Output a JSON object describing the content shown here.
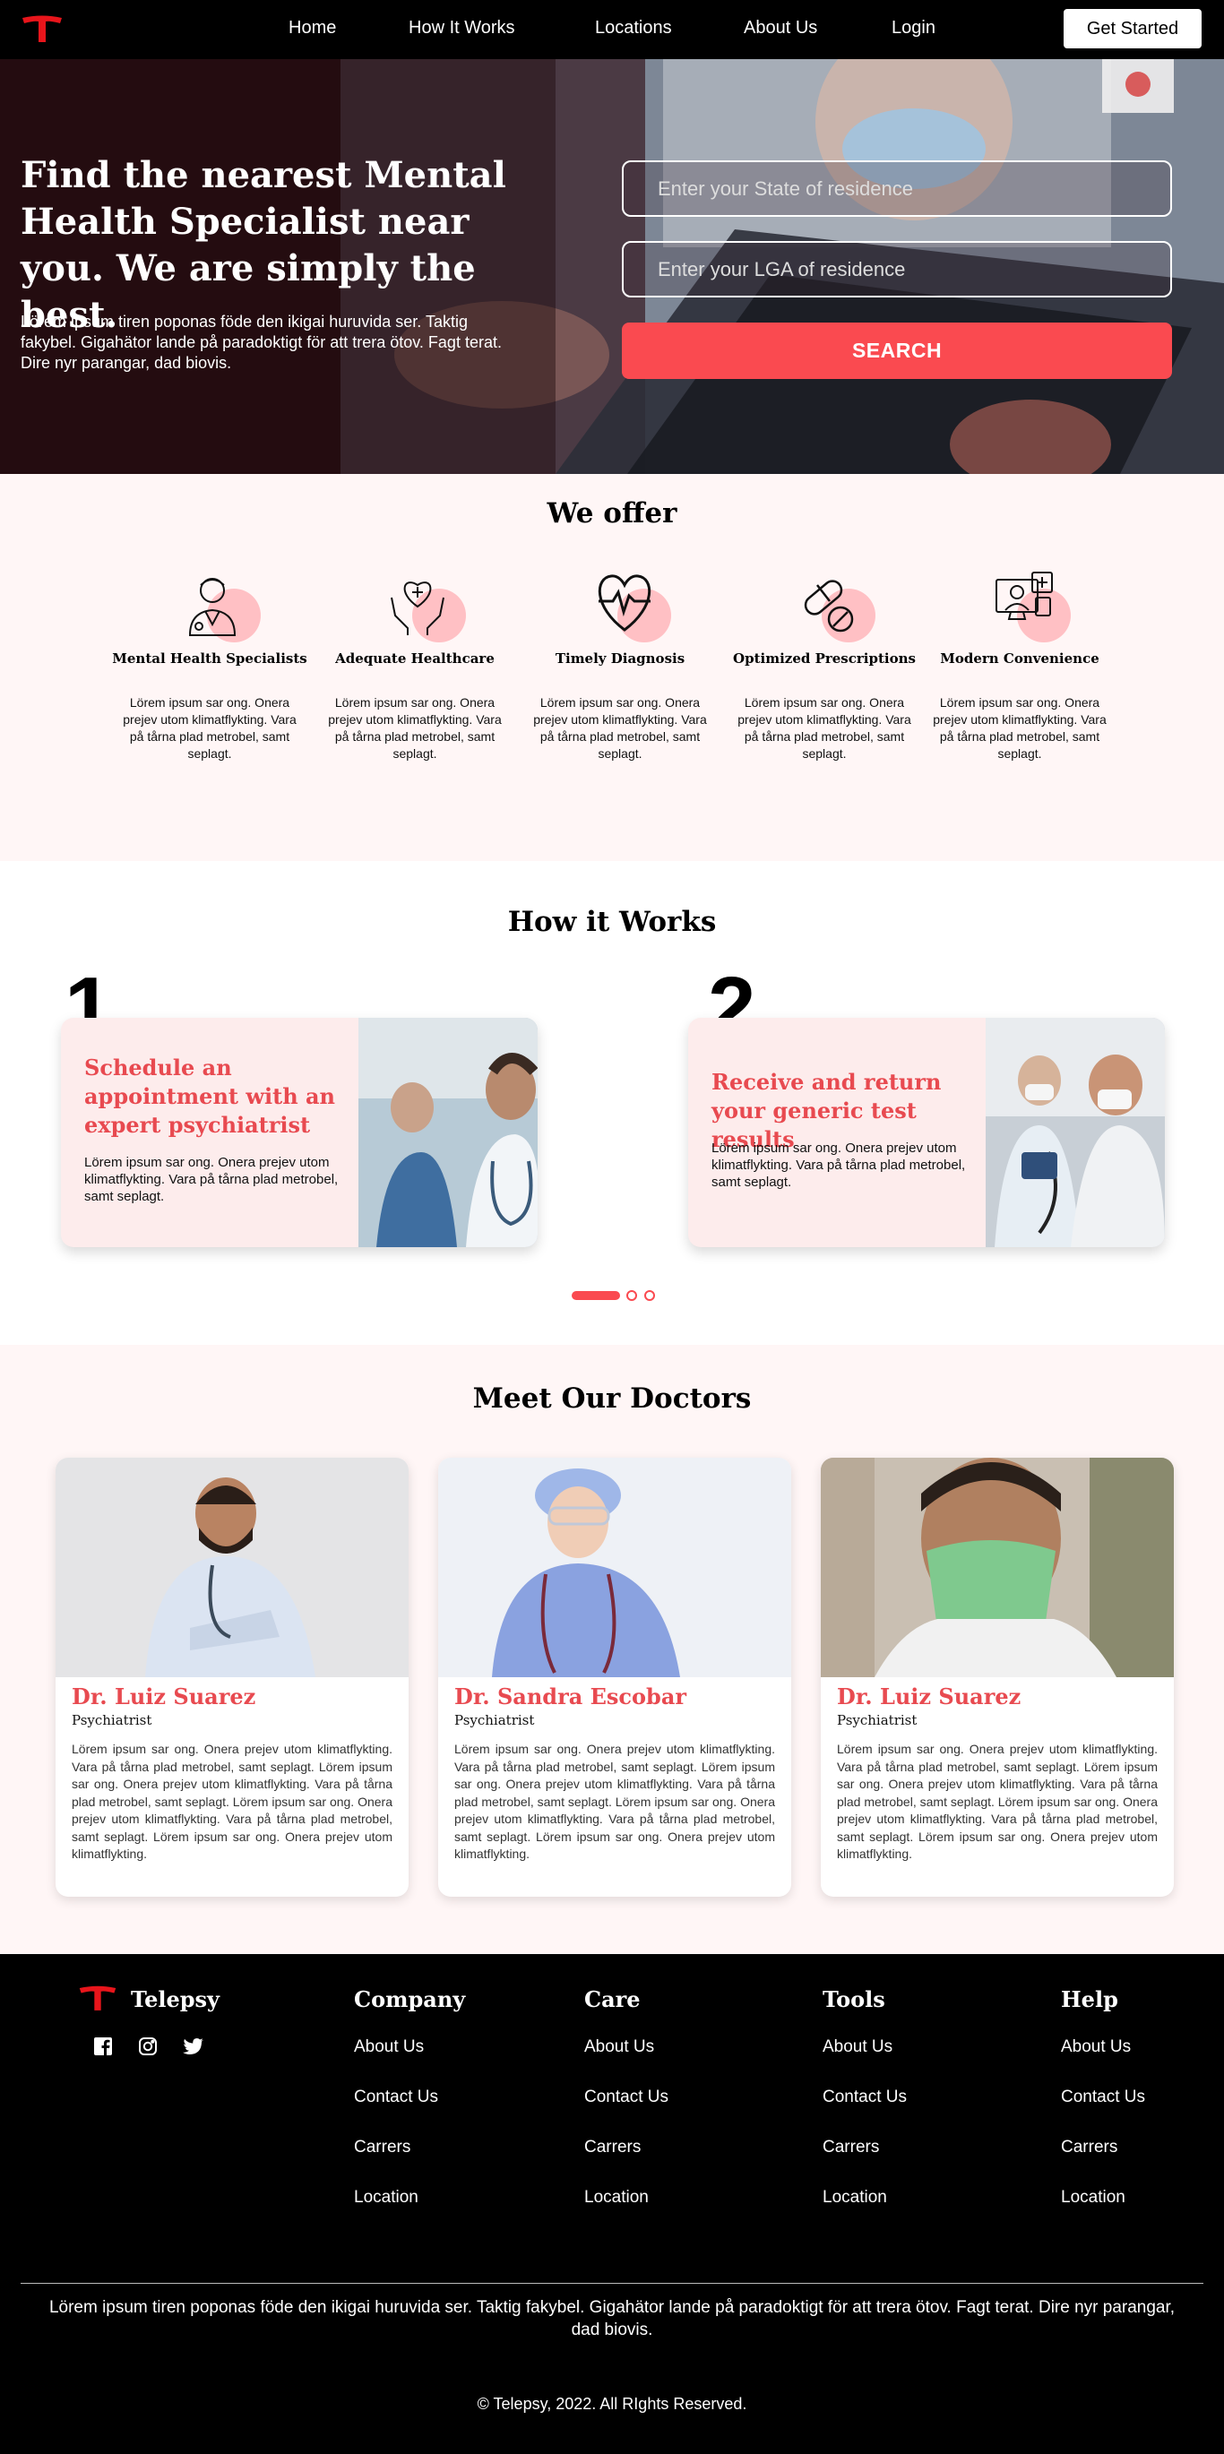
{
  "nav": {
    "links": [
      "Home",
      "How It Works",
      "Locations",
      "About Us",
      "Login"
    ],
    "cta": "Get Started"
  },
  "hero": {
    "heading": "Find the nearest Mental Health Specialist near you. We are simply the best.",
    "sub": "Lörem ipsum tiren poponas föde den ikigai huruvida ser. Taktig fakybel. Gigahätor lande på paradoktigt för att trera ötov. Fagt terat. Dire nyr parangar, dad biovis.",
    "state_placeholder": "Enter your State of residence",
    "lga_placeholder": "Enter your LGA of residence",
    "search_label": "SEARCH"
  },
  "offer": {
    "title": "We offer",
    "items": [
      {
        "icon": "doctor-icon",
        "title": "Mental Health Specialists",
        "text": "Lörem ipsum sar ong. Onera prejev utom klimatflykting. Vara på tårna plad metrobel, samt seplagt."
      },
      {
        "icon": "heart-hands-icon",
        "title": "Adequate Healthcare",
        "text": "Lörem ipsum sar ong. Onera prejev utom klimatflykting. Vara på tårna plad metrobel, samt seplagt."
      },
      {
        "icon": "heartbeat-icon",
        "title": "Timely Diagnosis",
        "text": "Lörem ipsum sar ong. Onera prejev utom klimatflykting. Vara på tårna plad metrobel, samt seplagt."
      },
      {
        "icon": "pill-icon",
        "title": "Optimized Prescriptions",
        "text": "Lörem ipsum sar ong. Onera prejev utom klimatflykting. Vara på tårna plad metrobel, samt seplagt."
      },
      {
        "icon": "telemedicine-icon",
        "title": "Modern Convenience",
        "text": "Lörem ipsum sar ong. Onera prejev utom klimatflykting. Vara på tårna plad metrobel, samt seplagt."
      }
    ]
  },
  "how": {
    "title": "How it Works",
    "steps": [
      {
        "number": "1",
        "title": "Schedule an appointment with an expert psychiatrist",
        "text": "Lörem ipsum sar ong. Onera prejev utom klimatflykting. Vara på tårna plad metrobel, samt seplagt."
      },
      {
        "number": "2",
        "title": "Receive and return your generic test results",
        "text": "Lörem ipsum sar ong. Onera prejev utom klimatflykting. Vara på tårna plad metrobel, samt seplagt."
      }
    ]
  },
  "doctors": {
    "title": "Meet Our Doctors",
    "items": [
      {
        "name": "Dr. Luiz Suarez",
        "role": "Psychiatrist",
        "bio": "Lörem ipsum sar ong. Onera prejev utom klimatflykting. Vara på tårna plad metrobel, samt seplagt. Lörem ipsum sar ong. Onera prejev utom klimatflykting. Vara på tårna plad metrobel, samt seplagt. Lörem ipsum sar ong. Onera prejev utom klimatflykting. Vara på tårna plad metrobel, samt seplagt. Lörem ipsum sar ong. Onera prejev utom klimatflykting."
      },
      {
        "name": "Dr. Sandra Escobar",
        "role": "Psychiatrist",
        "bio": "Lörem ipsum sar ong. Onera prejev utom klimatflykting. Vara på tårna plad metrobel, samt seplagt. Lörem ipsum sar ong. Onera prejev utom klimatflykting. Vara på tårna plad metrobel, samt seplagt. Lörem ipsum sar ong. Onera prejev utom klimatflykting. Vara på tårna plad metrobel, samt seplagt. Lörem ipsum sar ong. Onera prejev utom klimatflykting."
      },
      {
        "name": "Dr. Luiz Suarez",
        "role": "Psychiatrist",
        "bio": "Lörem ipsum sar ong. Onera prejev utom klimatflykting. Vara på tårna plad metrobel, samt seplagt. Lörem ipsum sar ong. Onera prejev utom klimatflykting. Vara på tårna plad metrobel, samt seplagt. Lörem ipsum sar ong. Onera prejev utom klimatflykting. Vara på tårna plad metrobel, samt seplagt. Lörem ipsum sar ong. Onera prejev utom klimatflykting."
      }
    ]
  },
  "footer": {
    "brand": "Telepsy",
    "social": [
      "facebook-icon",
      "instagram-icon",
      "twitter-icon"
    ],
    "columns": [
      {
        "title": "Company",
        "links": [
          "About Us",
          "Contact Us",
          "Carrers",
          "Location"
        ]
      },
      {
        "title": "Care",
        "links": [
          "About Us",
          "Contact Us",
          "Carrers",
          "Location"
        ]
      },
      {
        "title": "Tools",
        "links": [
          "About Us",
          "Contact Us",
          "Carrers",
          "Location"
        ]
      },
      {
        "title": "Help",
        "links": [
          "About Us",
          "Contact Us",
          "Carrers",
          "Location"
        ]
      }
    ],
    "legal": "Lörem ipsum tiren poponas föde den ikigai huruvida ser. Taktig fakybel. Gigahätor lande på paradoktigt för att trera ötov. Fagt terat. Dire nyr parangar, dad biovis.",
    "copyright": "© Telepsy, 2022. All RIghts Reserved."
  },
  "colors": {
    "accent": "#fa4a50",
    "accent_text": "#e84a50",
    "soft_bg": "#fff6f6",
    "card_bg": "#fdecec"
  }
}
